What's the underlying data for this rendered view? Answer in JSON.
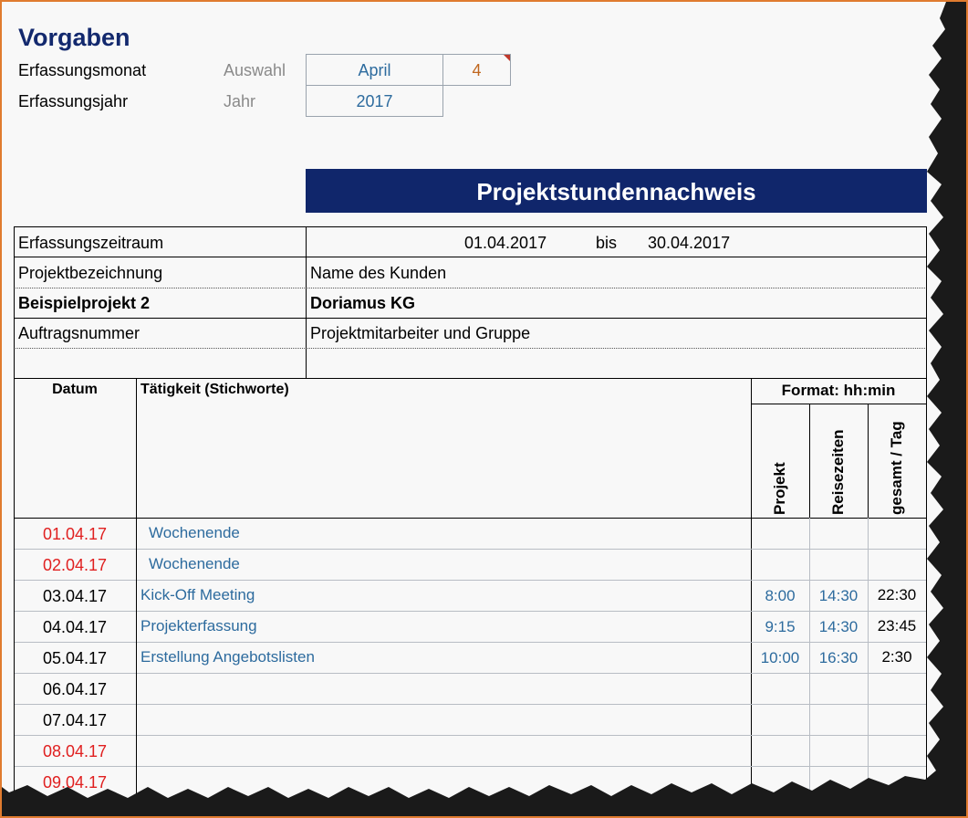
{
  "vorgaben": {
    "title": "Vorgaben",
    "month_label": "Erfassungsmonat",
    "month_hint": "Auswahl",
    "month_value": "April",
    "month_number": "4",
    "year_label": "Erfassungsjahr",
    "year_hint": "Jahr",
    "year_value": "2017"
  },
  "banner": {
    "title": "Projektstundennachweis"
  },
  "info": {
    "period_label": "Erfassungszeitraum",
    "period_from": "01.04.2017",
    "period_sep": "bis",
    "period_to": "30.04.2017",
    "project_label": "Projektbezeichnung",
    "customer_label": "Name des Kunden",
    "project_value": "Beispielprojekt 2",
    "customer_value": "Doriamus KG",
    "order_label": "Auftragsnummer",
    "staff_label": "Projektmitarbeiter und Gruppe"
  },
  "table": {
    "col_date": "Datum",
    "col_activity": "Tätigkeit (Stichworte)",
    "col_format": "Format: hh:min",
    "col_project": "Projekt",
    "col_travel": "Reisezeiten",
    "col_total": "gesamt / Tag",
    "rows": [
      {
        "date": "01.04.17",
        "activity": "Wochenende",
        "project": "",
        "travel": "",
        "total": ""
      },
      {
        "date": "02.04.17",
        "activity": "Wochenende",
        "project": "",
        "travel": "",
        "total": ""
      },
      {
        "date": "03.04.17",
        "activity": "Kick-Off Meeting",
        "project": "8:00",
        "travel": "14:30",
        "total": "22:30"
      },
      {
        "date": "04.04.17",
        "activity": "Projekterfassung",
        "project": "9:15",
        "travel": "14:30",
        "total": "23:45"
      },
      {
        "date": "05.04.17",
        "activity": "Erstellung Angebotslisten",
        "project": "10:00",
        "travel": "16:30",
        "total": "2:30"
      },
      {
        "date": "06.04.17",
        "activity": "",
        "project": "",
        "travel": "",
        "total": ""
      },
      {
        "date": "07.04.17",
        "activity": "",
        "project": "",
        "travel": "",
        "total": ""
      },
      {
        "date": "08.04.17",
        "activity": "",
        "project": "",
        "travel": "",
        "total": ""
      },
      {
        "date": "09.04.17",
        "activity": "",
        "project": "",
        "travel": "",
        "total": ""
      }
    ]
  },
  "colors": {
    "banner": "#10266b",
    "weekend": "#e02020",
    "value_blue": "#2d6b9e",
    "accent_orange": "#c0671f",
    "frame": "#e07b2f"
  }
}
